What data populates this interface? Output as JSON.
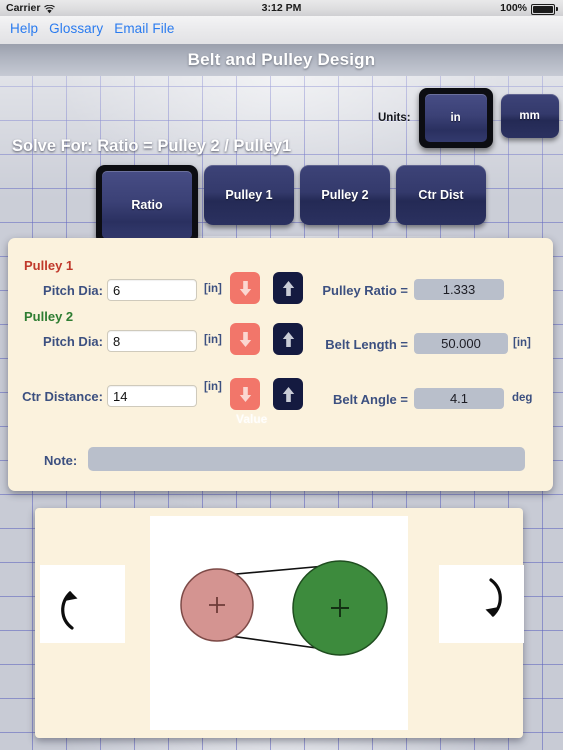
{
  "status_bar": {
    "carrier": "Carrier",
    "wifi_icon": "wifi-icon",
    "time": "3:12 PM",
    "battery_percent": "100%",
    "battery_icon": "battery-full-icon"
  },
  "toolbar": {
    "links": [
      {
        "label": "Help",
        "name": "help-link"
      },
      {
        "label": "Glossary",
        "name": "glossary-link"
      },
      {
        "label": "Email File",
        "name": "email-file-link"
      }
    ]
  },
  "header": {
    "title": "Belt and Pulley Design"
  },
  "units": {
    "label": "Units:",
    "options": [
      {
        "label": "in",
        "selected": true
      },
      {
        "label": "mm",
        "selected": false
      }
    ],
    "selected": "in"
  },
  "solve_for": {
    "text": "Solve For: Ratio = Pulley 2 / Pulley1",
    "buttons": [
      {
        "label": "Ratio",
        "selected": true
      },
      {
        "label": "Pulley 1",
        "selected": false
      },
      {
        "label": "Pulley 2",
        "selected": false
      },
      {
        "label": "Ctr Dist",
        "selected": false
      }
    ]
  },
  "inputs": {
    "value_hint": "Value",
    "pulley1": {
      "group_title": "Pulley 1",
      "group_color": "#c0392b",
      "field_label": "Pitch Dia:",
      "value": "6",
      "unit": "[in]",
      "decrement_icon": "arrow-down-icon",
      "increment_icon": "arrow-up-icon"
    },
    "pulley2": {
      "group_title": "Pulley 2",
      "group_color": "#2e7d32",
      "field_label": "Pitch Dia:",
      "value": "8",
      "unit": "[in]",
      "decrement_icon": "arrow-down-icon",
      "increment_icon": "arrow-up-icon"
    },
    "center_distance": {
      "field_label": "Ctr Distance:",
      "value": "14",
      "unit": "[in]",
      "decrement_icon": "arrow-down-icon",
      "increment_icon": "arrow-up-icon"
    }
  },
  "results": {
    "pulley_ratio": {
      "label": "Pulley Ratio =",
      "value": "1.333",
      "unit": ""
    },
    "belt_length": {
      "label": "Belt Length =",
      "value": "50.000",
      "unit": "[in]"
    },
    "belt_angle": {
      "label": "Belt Angle =",
      "value": "4.1",
      "unit": "deg"
    }
  },
  "note": {
    "label": "Note:",
    "value": "",
    "placeholder": ""
  },
  "diagram": {
    "pulley1_color": "#d49491",
    "pulley2_color": "#3d8b3d",
    "left_rotation_icon": "rotate-counterclockwise-icon",
    "right_rotation_icon": "rotate-clockwise-icon",
    "center_mark_icon": "plus-center-mark-icon"
  }
}
